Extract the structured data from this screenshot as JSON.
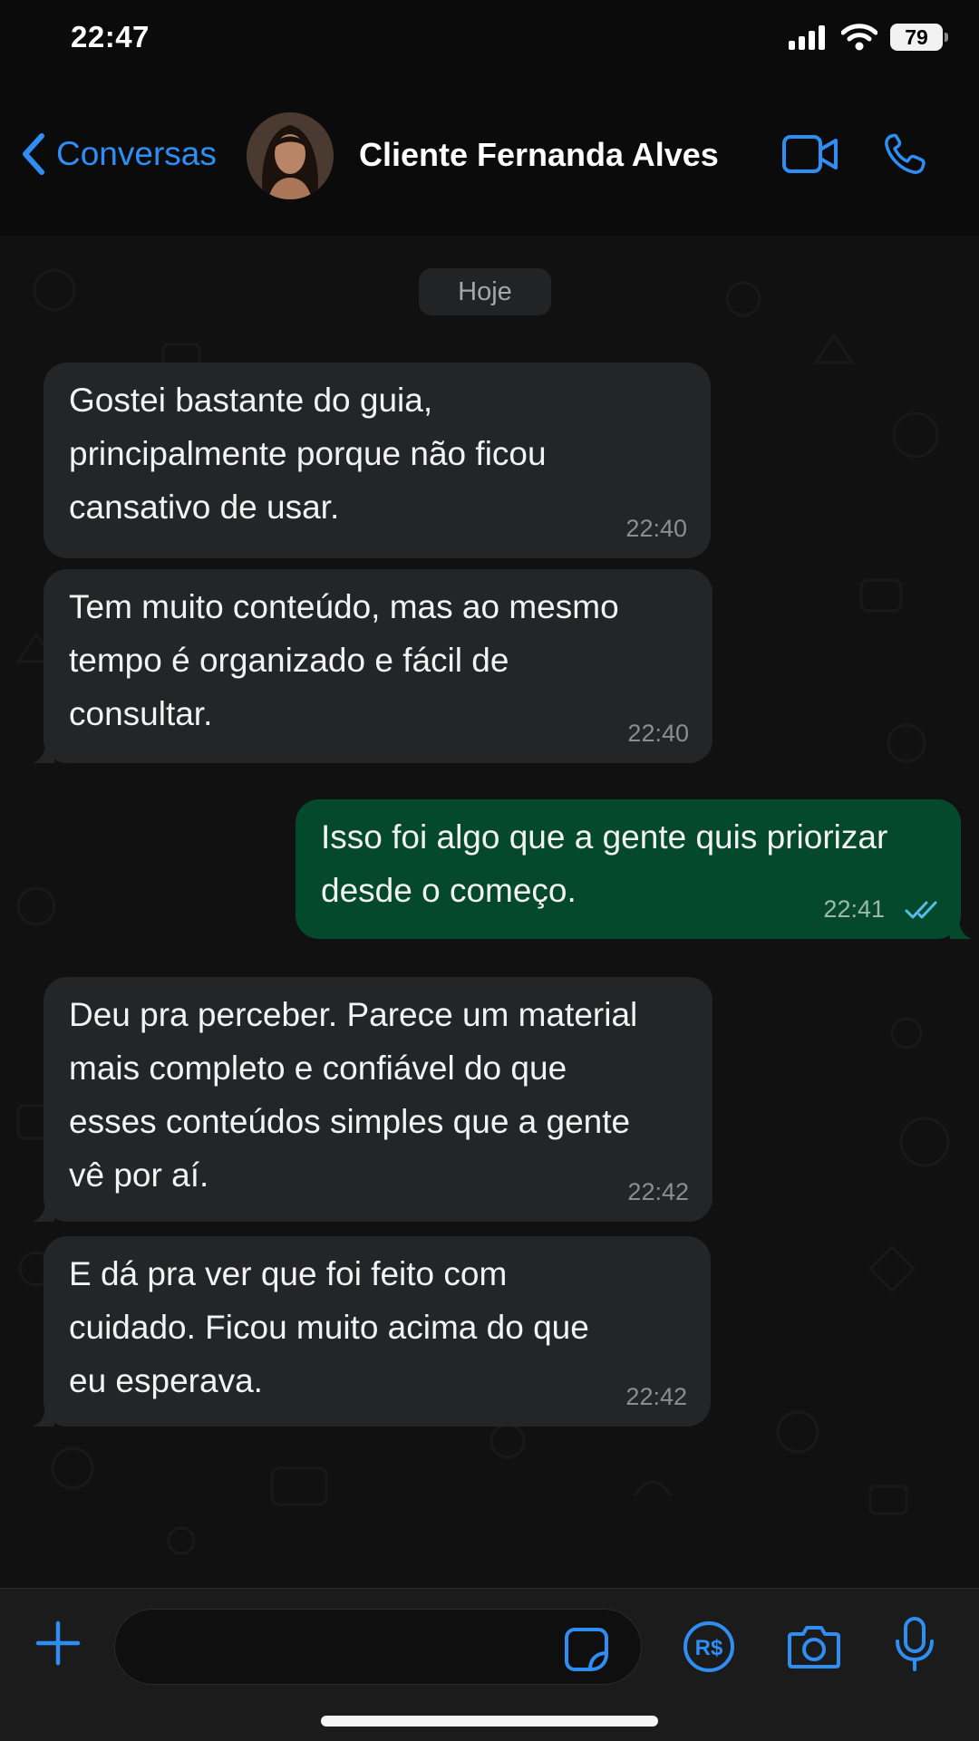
{
  "status_bar": {
    "time": "22:47",
    "battery": "79",
    "icons": [
      "cellular-signal-icon",
      "wifi-icon",
      "battery-icon"
    ]
  },
  "header": {
    "back_label": "Conversas",
    "contact_name": "Cliente Fernanda Alves",
    "icons": [
      "chevron-left-icon",
      "video-call-icon",
      "phone-call-icon"
    ],
    "accent_color": "#2e8ef4"
  },
  "chat": {
    "date_separator": "Hoje",
    "messages": [
      {
        "direction": "incoming",
        "text": "Gostei bastante do guia,\nprincipalmente porque não ficou\ncansativo de usar.",
        "time": "22:40"
      },
      {
        "direction": "incoming",
        "text": "Tem muito conteúdo, mas ao mesmo\ntempo é organizado e fácil de\nconsultar.",
        "time": "22:40"
      },
      {
        "direction": "outgoing",
        "text": "Isso foi algo que a gente quis priorizar\ndesde o começo.",
        "time": "22:41",
        "status": "read"
      },
      {
        "direction": "incoming",
        "text": "Deu pra perceber. Parece um material\nmais completo e confiável do que\nesses conteúdos simples que a gente\nvê por aí.",
        "time": "22:42"
      },
      {
        "direction": "incoming",
        "text": "E dá pra ver que foi feito com\ncuidado. Ficou muito acima do que\neu esperava.",
        "time": "22:42"
      }
    ],
    "incoming_color": "#242526",
    "outgoing_color": "#04492b"
  },
  "composer": {
    "input_value": "",
    "icons": [
      "plus-icon",
      "sticker-icon",
      "pix-payment-icon",
      "camera-icon",
      "microphone-icon"
    ],
    "pix_label": "R$"
  }
}
